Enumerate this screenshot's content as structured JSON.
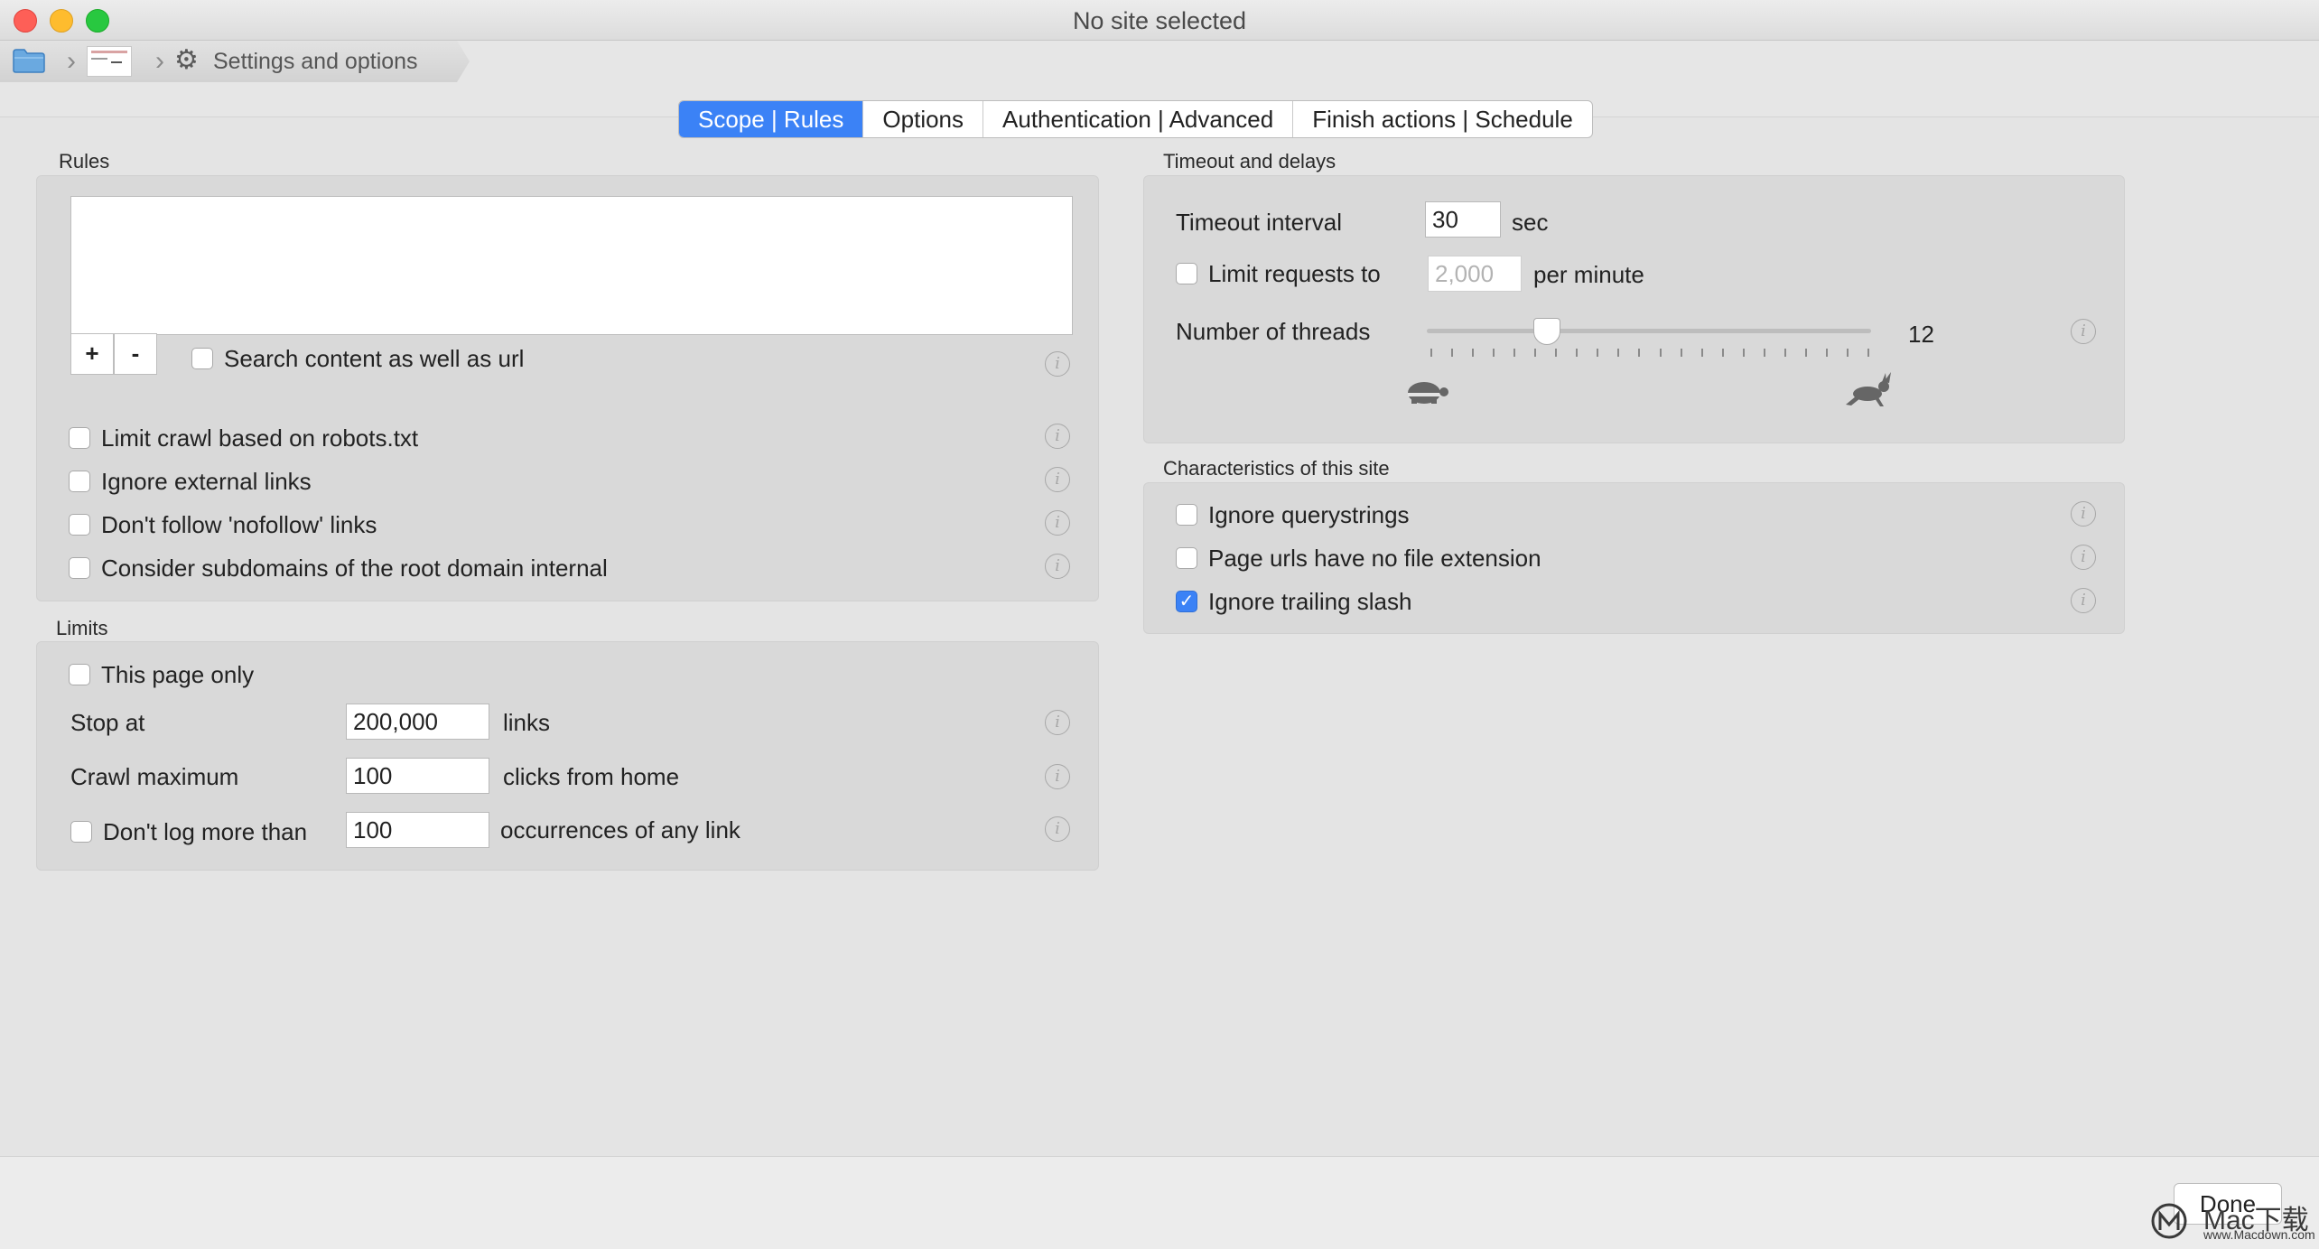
{
  "window": {
    "title": "No site selected"
  },
  "breadcrumb": {
    "label": "Settings and options"
  },
  "tabs": [
    {
      "label": "Scope | Rules",
      "active": true
    },
    {
      "label": "Options",
      "active": false
    },
    {
      "label": "Authentication | Advanced",
      "active": false
    },
    {
      "label": "Finish actions | Schedule",
      "active": false
    }
  ],
  "rules": {
    "title": "Rules",
    "add_label": "+",
    "remove_label": "-",
    "search_content": {
      "label": "Search content as well as url",
      "checked": false
    },
    "options": [
      {
        "label": "Limit crawl based on robots.txt",
        "checked": false
      },
      {
        "label": "Ignore external links",
        "checked": false
      },
      {
        "label": "Don't follow 'nofollow' links",
        "checked": false
      },
      {
        "label": "Consider subdomains of the root domain internal",
        "checked": false
      }
    ]
  },
  "limits": {
    "title": "Limits",
    "this_page_only": {
      "label": "This page only",
      "checked": false
    },
    "stop_at": {
      "label": "Stop at",
      "value": "200,000",
      "unit": "links"
    },
    "crawl_maximum": {
      "label": "Crawl maximum",
      "value": "100",
      "unit": "clicks from home"
    },
    "dont_log": {
      "label": "Don't log more than",
      "value": "100",
      "unit": "occurrences of any link",
      "checked": false
    }
  },
  "timeout": {
    "title": "Timeout and delays",
    "interval": {
      "label": "Timeout interval",
      "value": "30",
      "unit": "sec"
    },
    "limit_requests": {
      "label": "Limit requests to",
      "placeholder": "2,000",
      "unit": "per minute",
      "checked": false
    },
    "threads": {
      "label": "Number of threads",
      "value": "12",
      "fraction": 0.27
    },
    "slow_icon": "turtle-icon",
    "fast_icon": "rabbit-icon"
  },
  "characteristics": {
    "title": "Characteristics of this site",
    "options": [
      {
        "label": "Ignore querystrings",
        "checked": false
      },
      {
        "label": "Page urls have no file extension",
        "checked": false
      },
      {
        "label": "Ignore trailing slash",
        "checked": true
      }
    ]
  },
  "footer": {
    "done_label": "Done"
  },
  "watermark": {
    "text": "Mac下载",
    "url": "www.Macdown.com"
  },
  "colors": {
    "accent": "#3b82f6",
    "close": "#fe5f57",
    "minimize": "#febc2e",
    "maximize": "#28c840"
  }
}
